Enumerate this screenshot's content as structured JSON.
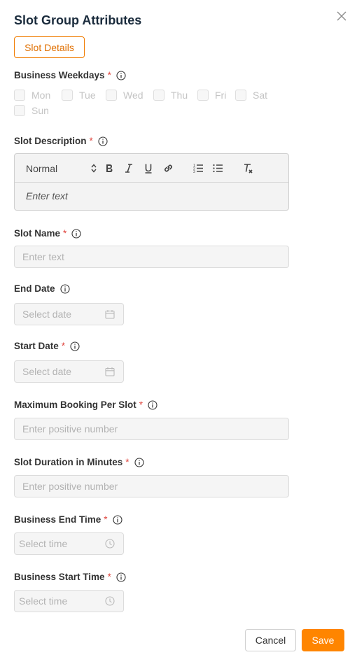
{
  "dialog": {
    "title": "Slot Group Attributes"
  },
  "tab": {
    "label": "Slot Details"
  },
  "weekdays": {
    "label": "Business Weekdays",
    "days": [
      "Mon",
      "Tue",
      "Wed",
      "Thu",
      "Fri",
      "Sat",
      "Sun"
    ]
  },
  "description": {
    "label": "Slot Description",
    "format_value": "Normal",
    "placeholder": "Enter text"
  },
  "slot_name": {
    "label": "Slot Name",
    "placeholder": "Enter text"
  },
  "end_date": {
    "label": "End Date",
    "placeholder": "Select date"
  },
  "start_date": {
    "label": "Start Date",
    "placeholder": "Select date"
  },
  "max_booking": {
    "label": "Maximum Booking Per Slot",
    "placeholder": "Enter positive number"
  },
  "duration": {
    "label": "Slot Duration in Minutes",
    "placeholder": "Enter positive number"
  },
  "end_time": {
    "label": "Business End Time",
    "placeholder": "Select time"
  },
  "start_time": {
    "label": "Business Start Time",
    "placeholder": "Select time"
  },
  "required_mark": "*",
  "actions": {
    "cancel": "Cancel",
    "save": "Save"
  },
  "colors": {
    "accent": "#ff8500",
    "required": "#e0463f",
    "title": "#1a2b3c"
  }
}
